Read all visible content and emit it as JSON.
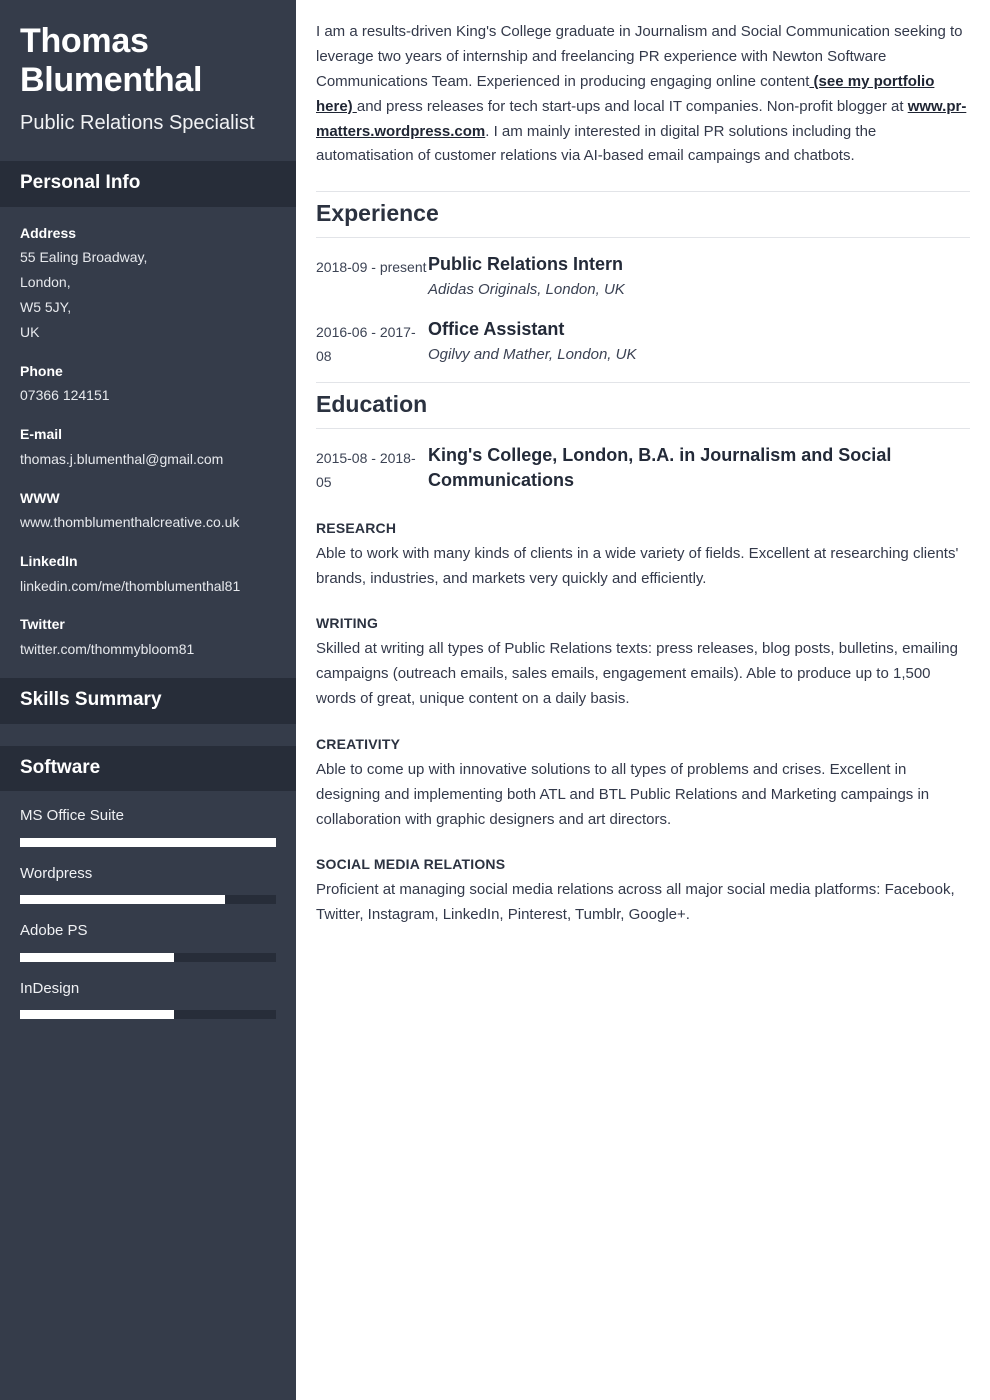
{
  "theme": {
    "sidebar_bg": "#353c4a",
    "sidebar_header_bg": "#272d39",
    "sidebar_text": "#ffffff",
    "main_bg": "#ffffff",
    "main_text": "#33394a",
    "rule_color": "#e2e4e8",
    "bar_fill": "#ffffff",
    "bar_track": "#272d39"
  },
  "sidebar": {
    "full_name": "Thomas Blumenthal",
    "job_title": "Public Relations Specialist",
    "personal_info": {
      "heading": "Personal Info",
      "groups": [
        {
          "label": "Address",
          "value": "55 Ealing Broadway,\nLondon,\nW5 5JY,\nUK"
        },
        {
          "label": "Phone",
          "value": "07366 124151"
        },
        {
          "label": "E-mail",
          "value": "thomas.j.blumenthal@gmail.com"
        },
        {
          "label": "WWW",
          "value": "www.thomblumenthalcreative.co.uk"
        },
        {
          "label": "LinkedIn",
          "value": "linkedin.com/me/thomblumenthal81"
        },
        {
          "label": "Twitter",
          "value": "twitter.com/thommybloom81"
        }
      ]
    },
    "skills_summary": {
      "heading": "Skills Summary",
      "items": []
    },
    "software": {
      "heading": "Software",
      "items": [
        {
          "name": "MS Office Suite",
          "level": 100
        },
        {
          "name": "Wordpress",
          "level": 80
        },
        {
          "name": "Adobe PS",
          "level": 60
        },
        {
          "name": "InDesign",
          "level": 60
        }
      ]
    }
  },
  "main": {
    "summary": {
      "parts": [
        {
          "type": "text",
          "text": "I am a results-driven King's College graduate in Journalism and Social Communication seeking to leverage two years of internship and freelancing PR experience with Newton Software Communications Team. Experienced in producing engaging online content"
        },
        {
          "type": "link",
          "text": " (see my portfolio here) "
        },
        {
          "type": "text",
          "text": "and press releases for tech start-ups and local IT companies. Non-profit blogger at "
        },
        {
          "type": "link",
          "text": "www.pr-matters.wordpress.com"
        },
        {
          "type": "text",
          "text": ". I am mainly interested in digital PR solutions including the automatisation of customer relations via AI-based email campaings and chatbots."
        }
      ]
    },
    "experience": {
      "title": "Experience",
      "entries": [
        {
          "date": "2018-09 - present",
          "role": "Public Relations Intern",
          "org": "Adidas Originals, London, UK"
        },
        {
          "date": "2016-06 - 2017-08",
          "role": "Office Assistant",
          "org": "Ogilvy and Mather, London, UK"
        }
      ]
    },
    "education": {
      "title": "Education",
      "entries": [
        {
          "date": "2015-08 - 2018-05",
          "role": "King's College, London, B.A. in Journalism and Social Communications",
          "org": ""
        }
      ]
    },
    "skills": [
      {
        "heading": "RESEARCH",
        "description": "Able to work with many kinds of clients in a wide variety of fields. Excellent at researching clients' brands, industries, and markets very quickly and efficiently."
      },
      {
        "heading": "WRITING",
        "description": "Skilled at writing all types of Public Relations texts: press releases, blog posts, bulletins, emailing campaigns (outreach emails, sales emails, engagement emails). Able to produce up to 1,500 words of great, unique content on a daily basis."
      },
      {
        "heading": "CREATIVITY",
        "description": "Able to come up with innovative solutions to all types of problems and crises. Excellent in designing and implementing both ATL and BTL Public Relations and Marketing campaings in collaboration with graphic designers and art directors."
      },
      {
        "heading": "SOCIAL MEDIA RELATIONS",
        "description": "Proficient at managing social media relations across all major social media platforms: Facebook, Twitter, Instagram, LinkedIn, Pinterest, Tumblr, Google+."
      }
    ]
  }
}
